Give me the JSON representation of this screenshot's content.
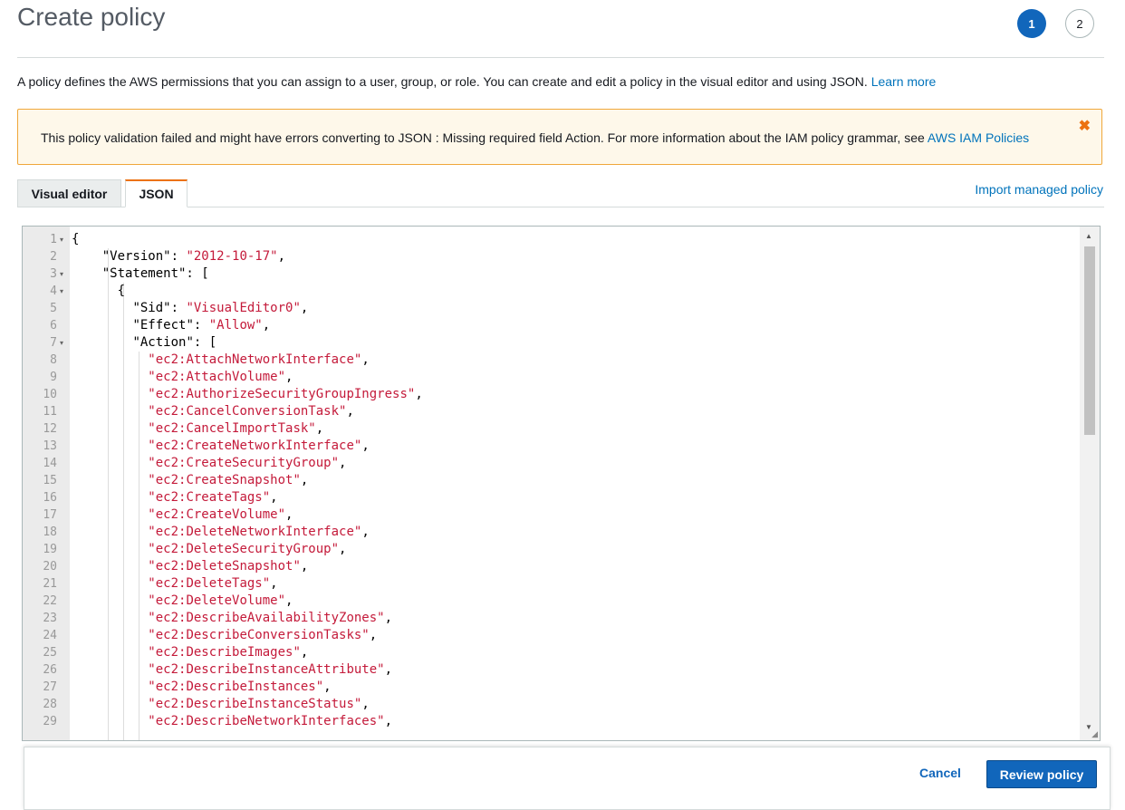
{
  "header": {
    "title": "Create policy",
    "steps": [
      "1",
      "2"
    ],
    "active_step": "1"
  },
  "description": {
    "text": "A policy defines the AWS permissions that you can assign to a user, group, or role. You can create and edit a policy in the visual editor and using JSON. ",
    "link": "Learn more"
  },
  "alert": {
    "text": "This policy validation failed and might have errors converting to JSON : Missing required field Action. For more information about the IAM policy grammar, see ",
    "link": "AWS IAM Policies",
    "close_icon": "close-icon"
  },
  "tabs": {
    "visual": "Visual editor",
    "json": "JSON",
    "active": "JSON"
  },
  "import_link": "Import managed policy",
  "editor": {
    "lines": [
      {
        "n": "1",
        "fold": true,
        "indent": "",
        "key": "",
        "text": "{",
        "str": "",
        "tail": ""
      },
      {
        "n": "2",
        "fold": false,
        "indent": "    ",
        "key": "\"Version\": ",
        "str": "\"2012-10-17\"",
        "tail": ","
      },
      {
        "n": "3",
        "fold": true,
        "indent": "    ",
        "key": "\"Statement\": [",
        "str": "",
        "tail": ""
      },
      {
        "n": "4",
        "fold": true,
        "indent": "      ",
        "key": "{",
        "str": "",
        "tail": ""
      },
      {
        "n": "5",
        "fold": false,
        "indent": "        ",
        "key": "\"Sid\": ",
        "str": "\"VisualEditor0\"",
        "tail": ","
      },
      {
        "n": "6",
        "fold": false,
        "indent": "        ",
        "key": "\"Effect\": ",
        "str": "\"Allow\"",
        "tail": ","
      },
      {
        "n": "7",
        "fold": true,
        "indent": "        ",
        "key": "\"Action\": [",
        "str": "",
        "tail": ""
      },
      {
        "n": "8",
        "fold": false,
        "indent": "          ",
        "key": "",
        "str": "\"ec2:AttachNetworkInterface\"",
        "tail": ","
      },
      {
        "n": "9",
        "fold": false,
        "indent": "          ",
        "key": "",
        "str": "\"ec2:AttachVolume\"",
        "tail": ","
      },
      {
        "n": "10",
        "fold": false,
        "indent": "          ",
        "key": "",
        "str": "\"ec2:AuthorizeSecurityGroupIngress\"",
        "tail": ","
      },
      {
        "n": "11",
        "fold": false,
        "indent": "          ",
        "key": "",
        "str": "\"ec2:CancelConversionTask\"",
        "tail": ","
      },
      {
        "n": "12",
        "fold": false,
        "indent": "          ",
        "key": "",
        "str": "\"ec2:CancelImportTask\"",
        "tail": ","
      },
      {
        "n": "13",
        "fold": false,
        "indent": "          ",
        "key": "",
        "str": "\"ec2:CreateNetworkInterface\"",
        "tail": ","
      },
      {
        "n": "14",
        "fold": false,
        "indent": "          ",
        "key": "",
        "str": "\"ec2:CreateSecurityGroup\"",
        "tail": ","
      },
      {
        "n": "15",
        "fold": false,
        "indent": "          ",
        "key": "",
        "str": "\"ec2:CreateSnapshot\"",
        "tail": ","
      },
      {
        "n": "16",
        "fold": false,
        "indent": "          ",
        "key": "",
        "str": "\"ec2:CreateTags\"",
        "tail": ","
      },
      {
        "n": "17",
        "fold": false,
        "indent": "          ",
        "key": "",
        "str": "\"ec2:CreateVolume\"",
        "tail": ","
      },
      {
        "n": "18",
        "fold": false,
        "indent": "          ",
        "key": "",
        "str": "\"ec2:DeleteNetworkInterface\"",
        "tail": ","
      },
      {
        "n": "19",
        "fold": false,
        "indent": "          ",
        "key": "",
        "str": "\"ec2:DeleteSecurityGroup\"",
        "tail": ","
      },
      {
        "n": "20",
        "fold": false,
        "indent": "          ",
        "key": "",
        "str": "\"ec2:DeleteSnapshot\"",
        "tail": ","
      },
      {
        "n": "21",
        "fold": false,
        "indent": "          ",
        "key": "",
        "str": "\"ec2:DeleteTags\"",
        "tail": ","
      },
      {
        "n": "22",
        "fold": false,
        "indent": "          ",
        "key": "",
        "str": "\"ec2:DeleteVolume\"",
        "tail": ","
      },
      {
        "n": "23",
        "fold": false,
        "indent": "          ",
        "key": "",
        "str": "\"ec2:DescribeAvailabilityZones\"",
        "tail": ","
      },
      {
        "n": "24",
        "fold": false,
        "indent": "          ",
        "key": "",
        "str": "\"ec2:DescribeConversionTasks\"",
        "tail": ","
      },
      {
        "n": "25",
        "fold": false,
        "indent": "          ",
        "key": "",
        "str": "\"ec2:DescribeImages\"",
        "tail": ","
      },
      {
        "n": "26",
        "fold": false,
        "indent": "          ",
        "key": "",
        "str": "\"ec2:DescribeInstanceAttribute\"",
        "tail": ","
      },
      {
        "n": "27",
        "fold": false,
        "indent": "          ",
        "key": "",
        "str": "\"ec2:DescribeInstances\"",
        "tail": ","
      },
      {
        "n": "28",
        "fold": false,
        "indent": "          ",
        "key": "",
        "str": "\"ec2:DescribeInstanceStatus\"",
        "tail": ","
      },
      {
        "n": "29",
        "fold": false,
        "indent": "          ",
        "key": "",
        "str": "\"ec2:DescribeNetworkInterfaces\"",
        "tail": ","
      }
    ]
  },
  "footer": {
    "cancel": "Cancel",
    "review": "Review policy"
  },
  "colors": {
    "primary": "#1166bb",
    "accent": "#ec7211",
    "string": "#c41a3a",
    "link": "#0073bb",
    "alert_bg": "#fef8ea"
  }
}
